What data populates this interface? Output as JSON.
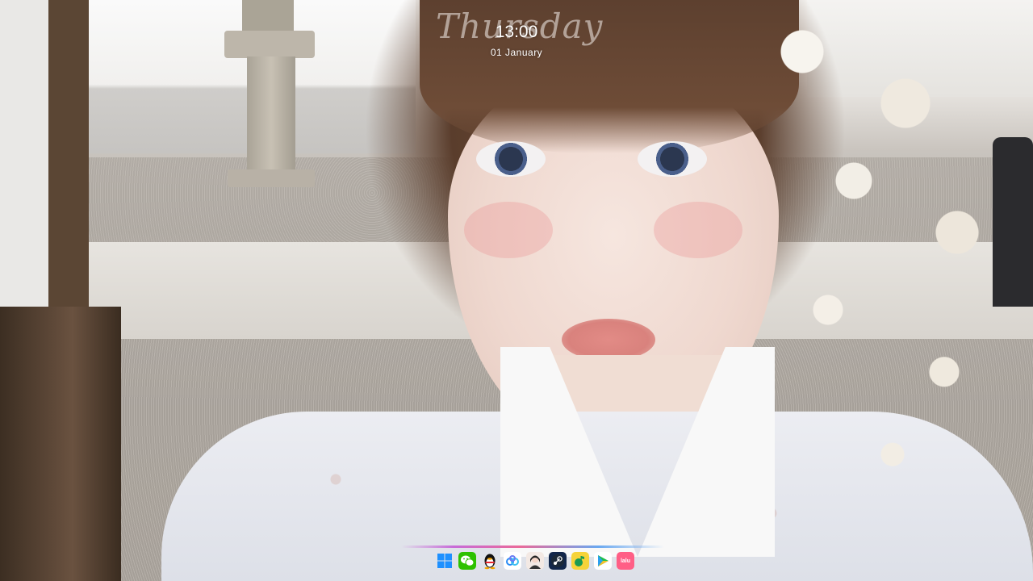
{
  "clock": {
    "weekday": "Thursday",
    "time": "13:00",
    "date": "01 January"
  },
  "dock": {
    "items": [
      {
        "app": "Windows",
        "icon": "windows-logo-icon"
      },
      {
        "app": "WeChat",
        "icon": "wechat-icon"
      },
      {
        "app": "QQ",
        "icon": "qq-penguin-icon"
      },
      {
        "app": "Baidu Netdisk",
        "icon": "cloud-icon"
      },
      {
        "app": "Avatar app",
        "icon": "avatar-icon"
      },
      {
        "app": "Steam",
        "icon": "steam-icon"
      },
      {
        "app": "Music",
        "icon": "music-icon"
      },
      {
        "app": "Video Player",
        "icon": "play-icon"
      },
      {
        "app": "Lalu",
        "icon": "lalu-icon",
        "label": "lalu"
      }
    ]
  },
  "colors": {
    "dock_accent_left": "#c76bd8",
    "dock_accent_mid": "#ea6a9a",
    "dock_accent_right": "#6aa8f0"
  }
}
